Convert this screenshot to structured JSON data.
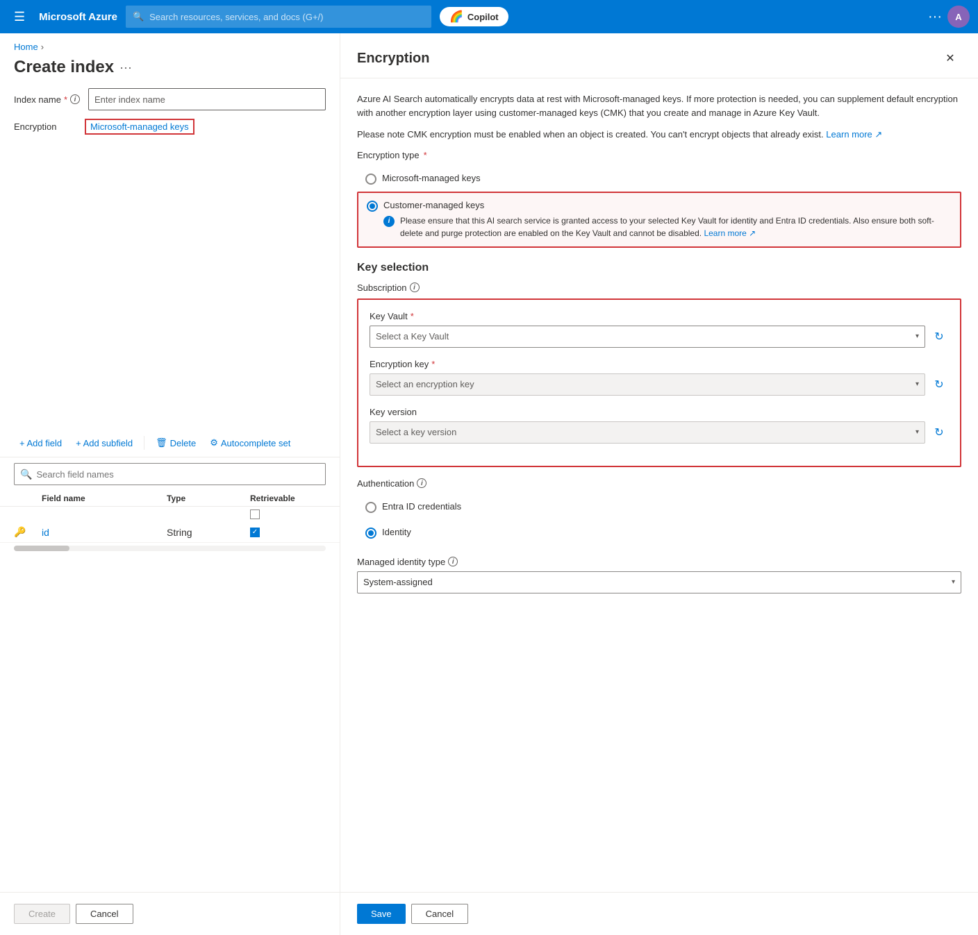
{
  "nav": {
    "hamburger_icon": "☰",
    "brand": "Microsoft Azure",
    "search_placeholder": "Search resources, services, and docs (G+/)",
    "copilot_label": "Copilot",
    "dots": "···",
    "avatar_initials": "A"
  },
  "breadcrumb": {
    "home": "Home",
    "separator": "›"
  },
  "create_index": {
    "title": "Create index",
    "dots": "···",
    "index_name_label": "Index name",
    "index_name_required": "*",
    "index_name_placeholder": "Enter index name",
    "encryption_label": "Encryption",
    "encryption_link": "Microsoft-managed keys",
    "add_field": "+ Add field",
    "add_subfield": "+ Add subfield",
    "delete": "Delete",
    "autocomplete": "Autocomplete set",
    "search_placeholder": "Search field names",
    "table_headers": {
      "field_name": "Field name",
      "type": "Type",
      "retrievable": "Retrievable"
    },
    "table_rows": [
      {
        "icon": "🔑",
        "name": "id",
        "type": "String",
        "retrievable": true
      }
    ],
    "create_btn": "Create",
    "cancel_btn": "Cancel"
  },
  "encryption_panel": {
    "title": "Encryption",
    "close_icon": "✕",
    "intro_1": "Azure AI Search automatically encrypts data at rest with Microsoft-managed keys. If more protection is needed, you can supplement default encryption with another encryption layer using customer-managed keys (CMK) that you create and manage in Azure Key Vault.",
    "intro_2": "Please note CMK encryption must be enabled when an object is created. You can't encrypt objects that already exist.",
    "learn_more_1": "Learn more",
    "learn_more_ext": "↗",
    "encryption_type_label": "Encryption type",
    "encryption_required": "*",
    "radio_options": [
      {
        "id": "microsoft",
        "label": "Microsoft-managed keys",
        "selected": false
      },
      {
        "id": "customer",
        "label": "Customer-managed keys",
        "selected": true
      }
    ],
    "info_text": "Please ensure that this AI search service is granted access to your selected Key Vault for identity and Entra ID credentials. Also ensure both soft-delete and purge protection are enabled on the Key Vault and cannot be disabled.",
    "info_learn_more": "Learn more",
    "key_selection_title": "Key selection",
    "subscription_label": "Subscription",
    "key_vault_label": "Key Vault",
    "key_vault_required": "*",
    "key_vault_placeholder": "Select a Key Vault",
    "encryption_key_label": "Encryption key",
    "encryption_key_required": "*",
    "encryption_key_placeholder": "Select an encryption key",
    "key_version_label": "Key version",
    "key_version_placeholder": "Select a key version",
    "authentication_label": "Authentication",
    "auth_options": [
      {
        "id": "entra",
        "label": "Entra ID credentials",
        "selected": false
      },
      {
        "id": "identity",
        "label": "Identity",
        "selected": true
      }
    ],
    "managed_identity_label": "Managed identity type",
    "managed_identity_placeholder": "System-assigned",
    "save_btn": "Save",
    "cancel_btn": "Cancel",
    "refresh_icon": "↻"
  }
}
